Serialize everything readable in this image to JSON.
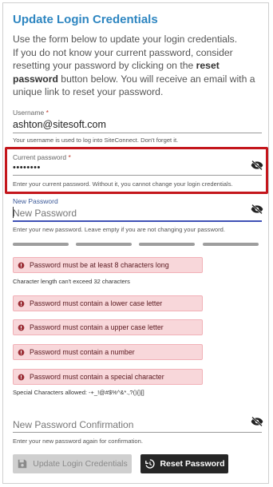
{
  "title": "Update Login Credentials",
  "intro": {
    "line1": "Use the form below to update your login credentials.",
    "line2_pre": "If you do not know your current password, consider resetting your password by clicking on the ",
    "line2_bold": "reset password",
    "line2_post": " button below. You will receive an email with a unique link to reset your password."
  },
  "username": {
    "label": "Username",
    "required_mark": "*",
    "value": "ashton@sitesoft.com",
    "helper": "Your username is used to log into SiteConnect. Don't forget it."
  },
  "current_password": {
    "label": "Current password",
    "required_mark": "*",
    "value": "••••••••",
    "helper": "Enter your current password. Without it, you cannot change your login credentials."
  },
  "new_password": {
    "label": "New Password",
    "placeholder": "New Password",
    "helper": "Enter your new password. Leave empty if you are not changing your password."
  },
  "validation": {
    "errors": [
      "Password must be at least 8 characters long",
      "Password must contain a lower case letter",
      "Password must contain a upper case letter",
      "Password must contain a number",
      "Password must contain a special character"
    ],
    "length_note": "Character length can't exceed 32 characters",
    "special_note": "Special Characters allowed: -+_!@#$%^&*.,?(){}[]"
  },
  "confirmation": {
    "placeholder": "New Password Confirmation",
    "helper": "Enter your new password again for confirmation."
  },
  "buttons": {
    "update_label": "Update Login Credentials",
    "reset_label": "Reset Password"
  },
  "colors": {
    "title": "#2e86c1",
    "highlight": "#c4161c",
    "active_field": "#3f51b5",
    "error_bg": "#f8d7da",
    "reset_button": "#262626"
  },
  "icons": [
    "eye-off-icon",
    "error-icon",
    "save-icon",
    "history-icon"
  ]
}
